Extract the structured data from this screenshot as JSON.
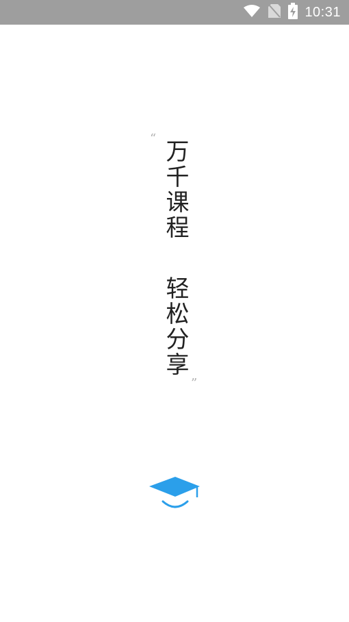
{
  "status_bar": {
    "time": "10:31",
    "icons": [
      "wifi-icon",
      "no-sim-icon",
      "battery-charging-icon"
    ],
    "background": "#9e9e9e"
  },
  "splash": {
    "quote_open": "“",
    "line_1": "万千课程",
    "line_2": "轻松分享",
    "quote_close": "”"
  },
  "logo": {
    "icon": "graduation-cap-smile-icon",
    "color": "#2b9fea"
  }
}
